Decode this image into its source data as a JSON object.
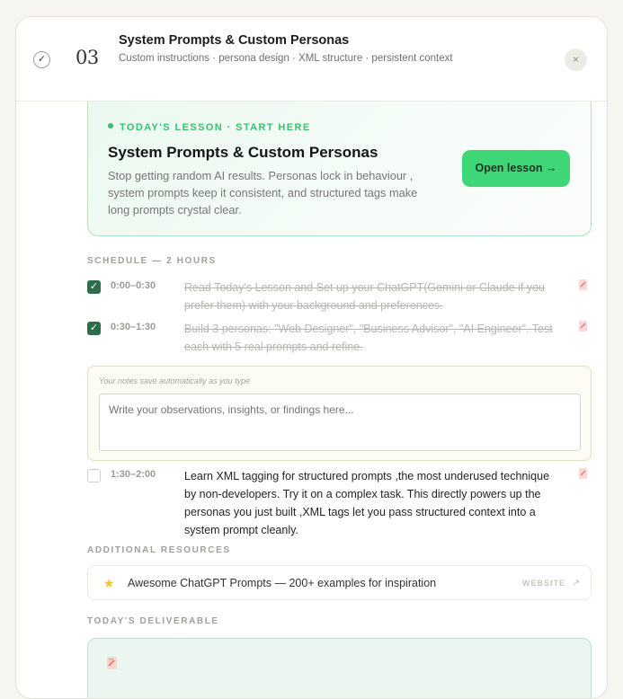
{
  "header": {
    "day_number": "03",
    "title": "System Prompts & Custom Personas",
    "subtitle": "Custom instructions · persona design · XML structure · persistent context",
    "close_symbol": "×",
    "completed_check": "✓"
  },
  "lesson": {
    "tag": "TODAY'S LESSON · START HERE",
    "title": "System Prompts & Custom Personas",
    "description": "Stop getting random AI results. Personas lock in behaviour , system prompts keep it consistent, and structured tags make long prompts crystal clear.",
    "button_label": "Open lesson →"
  },
  "schedule": {
    "label": "SCHEDULE — 2 HOURS",
    "tasks": [
      {
        "checked": true,
        "time": "0:00–0:30",
        "text": "Read Today's Lesson and Set up your ChatGPT(Gemini or Claude if you prefer them) with your background and preferences."
      },
      {
        "checked": true,
        "time": "0:30–1:30",
        "text": "Build 3 personas: \"Web Designer\", \"Business Advisor\", \"AI Engineer\". Test each with 5 real prompts and refine."
      },
      {
        "checked": false,
        "time": "1:30–2:00",
        "text": "Learn XML tagging for structured prompts ,the most underused technique by non-developers. Try it on a complex task. This directly powers up the personas you just built ,XML tags let you pass structured context into a system prompt cleanly."
      }
    ]
  },
  "notes": {
    "hint": "Your notes save automatically as you type",
    "placeholder": "Write your observations, insights, or findings here..."
  },
  "resources": {
    "label": "ADDITIONAL RESOURCES",
    "items": [
      {
        "icon": "star-icon",
        "title": "Awesome ChatGPT Prompts — 200+ examples for inspiration",
        "kind": "WEBSITE",
        "external_symbol": "↗"
      }
    ]
  },
  "deliverable": {
    "label": "TODAY'S DELIVERABLE"
  },
  "colors": {
    "accent_green": "#3fd677",
    "checkbox_green": "#2c6e49",
    "lesson_tag_green": "#35c46b"
  }
}
